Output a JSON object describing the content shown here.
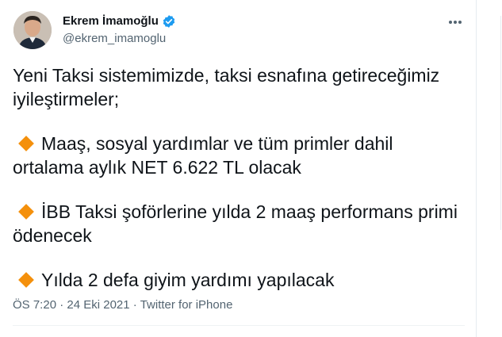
{
  "user": {
    "display_name": "Ekrem İmamoğlu",
    "handle": "@ekrem_imamoglu",
    "verified": true
  },
  "tweet": {
    "intro": "Yeni Taksi sistemimizde, taksi esnafına getireceğimiz iyileştirmeler;",
    "bullets": [
      "Maaş, sosyal yardımlar ve tüm primler dahil ortalama aylık NET 6.622 TL olacak",
      "İBB Taksi şoförlerine yılda 2 maaş performans primi ödenecek",
      "Yılda 2 defa giyim yardımı yapılacak"
    ],
    "bullet_icon": "orange-diamond-icon",
    "time": "ÖS 7:20",
    "separator": " · ",
    "date": "24 Eki 2021",
    "source": "Twitter for iPhone"
  },
  "colors": {
    "text": "#0f1419",
    "secondary": "#536471",
    "verified": "#1d9bf0",
    "bullet": "#f4900c"
  }
}
